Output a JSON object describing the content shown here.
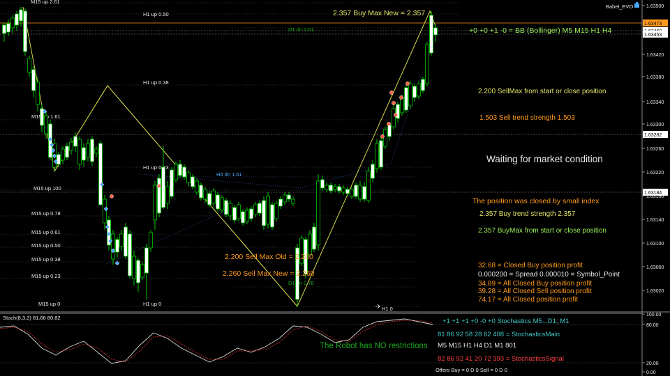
{
  "window": {
    "title": "Babel_EVO"
  },
  "colors": {
    "background": "#000000",
    "grid": "#5a5a5a",
    "bull_candle": "#ffffff",
    "bear_candle": "#000000",
    "candle_outline": "#00c400",
    "zigzag": "#d8d84a",
    "level_line": "#9a9a9a",
    "orange_text": "#ff9a1e",
    "yellow_text": "#e6e66a",
    "green_text": "#9af05a",
    "white_text": "#e8e8e8",
    "cyan_text": "#40c8c8",
    "red_text": "#ff4040",
    "dark_green_text": "#1ea81e",
    "marker_red": "#ff6040",
    "marker_blue": "#4aa8ff"
  },
  "price_axis": {
    "ticks": [
      "1.63500",
      "1.63460",
      "1.63420",
      "1.63380",
      "1.63340",
      "1.63300",
      "1.63260",
      "1.63220",
      "1.63180",
      "1.63140",
      "1.63100",
      "1.63060",
      "1.63020"
    ],
    "tags": [
      {
        "value": "1.63473",
        "style": "orange"
      },
      {
        "value": "1.63460",
        "style": "white"
      },
      {
        "value": "1.63453",
        "style": "white"
      },
      {
        "value": "1.63282",
        "style": "white"
      },
      {
        "value": "1.63184",
        "style": "white"
      }
    ]
  },
  "level_labels": [
    {
      "text": "M15 up 2.61"
    },
    {
      "text": "H1 up 0.50"
    },
    {
      "text": "D1 dn 0.61"
    },
    {
      "text": "H1 up 0.38"
    },
    {
      "text": "M15 up 1.61"
    },
    {
      "text": "H1 up 0.23"
    },
    {
      "text": "H4 dn 1.61"
    },
    {
      "text": "M15 up 100"
    },
    {
      "text": "M15 up 0.78"
    },
    {
      "text": "M15 up 0.61"
    },
    {
      "text": "M15 up 0.50"
    },
    {
      "text": "M15 up 0.38"
    },
    {
      "text": "M15 up 0.23"
    },
    {
      "text": "D1 dn 0.78"
    },
    {
      "text": "M15 up 0"
    },
    {
      "text": "H1 up 0"
    },
    {
      "text": "H1 0"
    }
  ],
  "annotations": {
    "buy_max_new": "2.357 Buy Max New = 2.357",
    "bb": "+0 +0 +1 -0 = BB (Bollinger) M5 M15 H1 H4",
    "sellmax_start": "2.200 SellMax from start or close position",
    "sell_trend": "1.503  Sell trend strength 1.503",
    "waiting": "Waiting for market condition",
    "closed_small": "The position was closed by small index",
    "buy_trend": "2.357  Buy trend strength 2.357",
    "buymax_start": "2.357 BuyMax from start or close position",
    "sell_max_old": "2.200 Sell Max Old = 2.200",
    "sell_max_new": "2.260 Sell Max New = 2.260",
    "closed_buy": "32.68 = Closed Buy position profit",
    "spread": "0.000200 = Spread   0.000010 = Symbol_Point",
    "all_closed_buy": "34.89 =  All Closed Buy position profit",
    "all_closed_sell": "39.28 =  All Closed Sell position profit",
    "all_closed": "74.17 =  All Closed position profit"
  },
  "indicator": {
    "name": "Stoch(8,3,3) 81.66 80.82",
    "axis_ticks": [
      "100.00",
      "80.00",
      "20.00",
      "0.00"
    ],
    "stoch_line": "+1  +1  +1  +0  -0  +0    Stochastics M5...D1; M1",
    "robot": "The Robot has NO restrictions",
    "main_values": "81  86  92  58  28  62  408 = StochasticsMain",
    "timeframes": "M5  M15 H1  H4  D1  M1  801",
    "signal_values": "82  86  92  41  20  72  393 = StochasticsSignal",
    "offers": "Offers Buy = 0 D 0   Sell = 0 D 0"
  }
}
